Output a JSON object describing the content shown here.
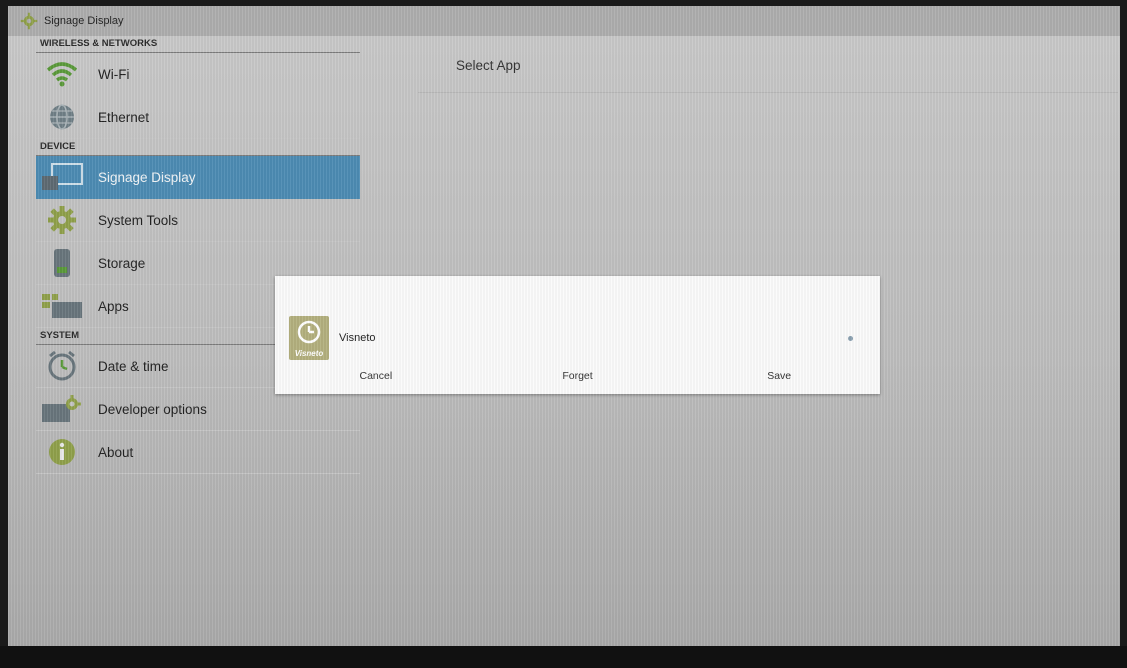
{
  "titlebar": {
    "title": "Signage Display"
  },
  "sidebar": {
    "sections": [
      {
        "label": "WIRELESS & NETWORKS"
      },
      {
        "label": "DEVICE"
      },
      {
        "label": "SYSTEM"
      }
    ],
    "items": [
      {
        "label": "Wi-Fi",
        "icon": "wifi-icon"
      },
      {
        "label": "Ethernet",
        "icon": "globe-icon"
      },
      {
        "label": "Signage Display",
        "icon": "display-icon",
        "active": true
      },
      {
        "label": "System Tools",
        "icon": "gear-icon"
      },
      {
        "label": "Storage",
        "icon": "storage-icon"
      },
      {
        "label": "Apps",
        "icon": "apps-icon"
      },
      {
        "label": "Date & time",
        "icon": "clock-icon"
      },
      {
        "label": "Developer options",
        "icon": "developer-icon"
      },
      {
        "label": "About",
        "icon": "info-icon"
      }
    ]
  },
  "main": {
    "title": "Select App"
  },
  "dialog": {
    "app": {
      "name": "Visneto",
      "brand": "Visneto",
      "icon": "clock-app-icon"
    },
    "buttons": {
      "cancel": "Cancel",
      "forget": "Forget",
      "save": "Save"
    }
  },
  "colors": {
    "accent": "#4c8bb3",
    "background": "#c4c4c4",
    "dialog": "#fbfbfb",
    "app_icon": "#b3b07e"
  }
}
